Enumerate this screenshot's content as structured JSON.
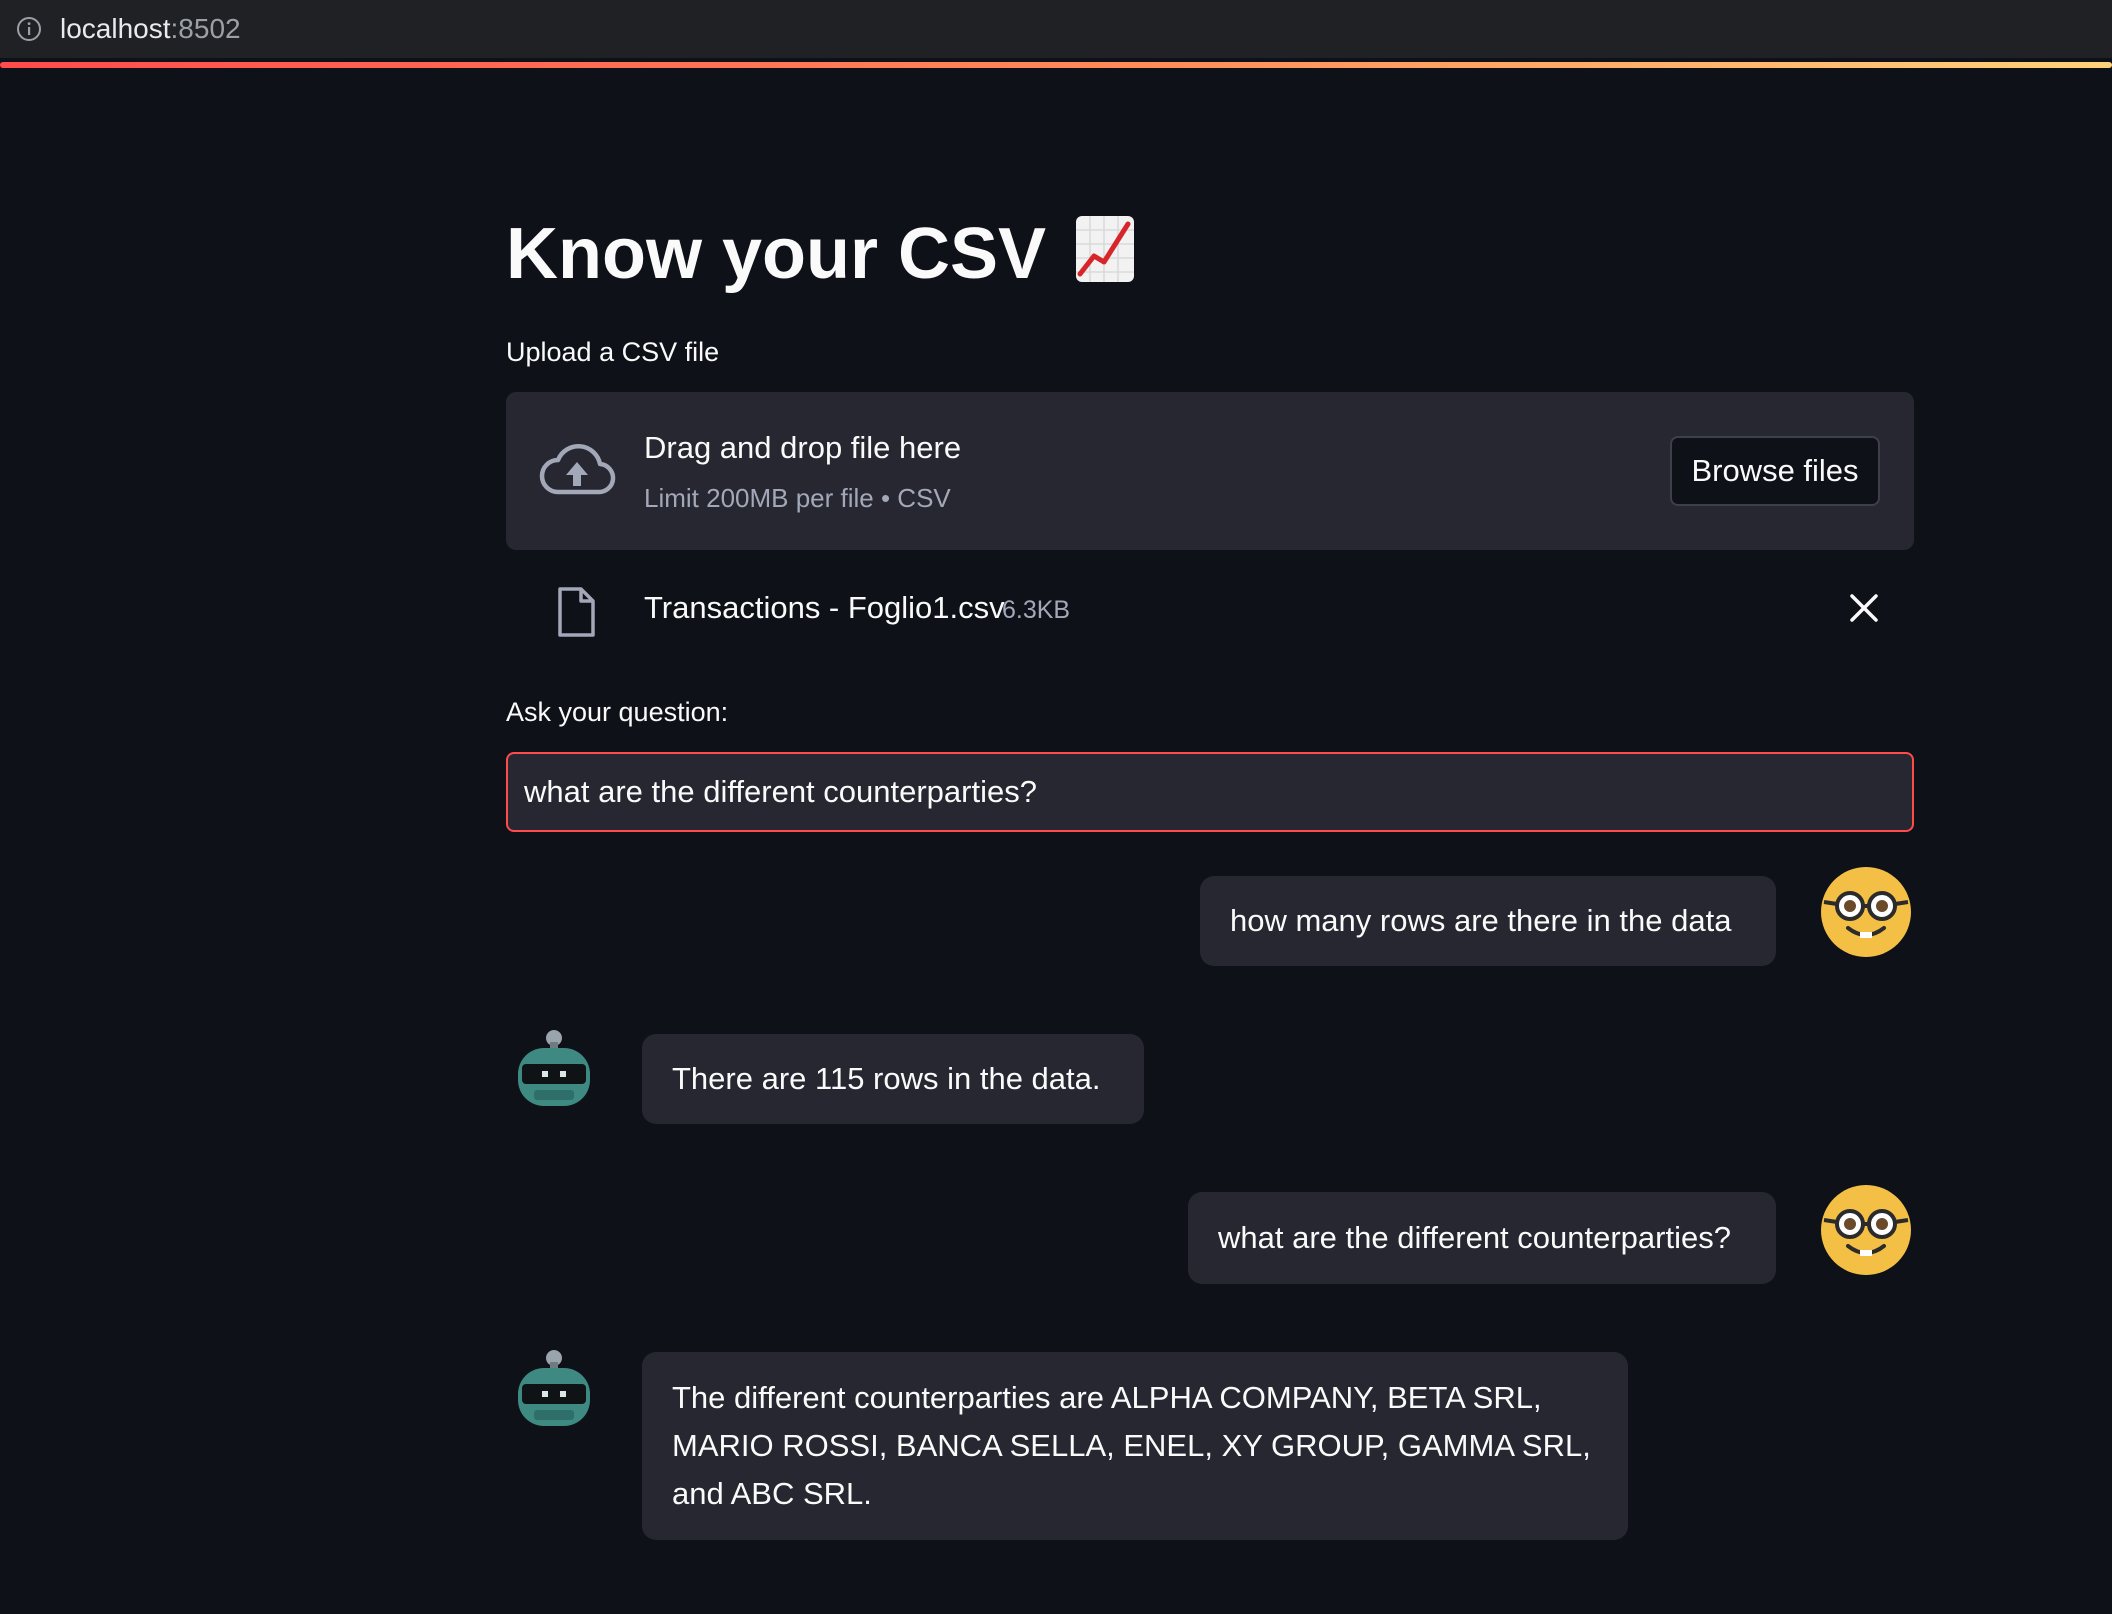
{
  "browser": {
    "url_host": "localhost",
    "url_port": ":8502"
  },
  "app": {
    "title": "Know your CSV",
    "title_icon": "chart-increasing-emoji"
  },
  "uploader": {
    "label": "Upload a CSV file",
    "drop_text": "Drag and drop file here",
    "limit_text": "Limit 200MB per file • CSV",
    "browse_label": "Browse files",
    "file_name": "Transactions - Foglio1.csv",
    "file_size": "6.3KB",
    "icons": [
      "cloud-upload-icon",
      "file-icon",
      "close-icon"
    ]
  },
  "question": {
    "label": "Ask your question:",
    "value": "what are the different counterparties?"
  },
  "chat": {
    "messages": [
      {
        "role": "user",
        "avatar": "nerd-face-avatar",
        "text": "how many rows are there in the data"
      },
      {
        "role": "assistant",
        "avatar": "robot-avatar",
        "text": "There are 115 rows in the data."
      },
      {
        "role": "user",
        "avatar": "nerd-face-avatar",
        "text": "what are the different counterparties?"
      },
      {
        "role": "assistant",
        "avatar": "robot-avatar",
        "text": "The different counterparties are ALPHA COMPANY, BETA SRL, MARIO ROSSI, BANCA SELLA, ENEL, XY GROUP, GAMMA SRL, and ABC SRL."
      }
    ]
  },
  "colors": {
    "background": "#0e1117",
    "surface": "#262730",
    "accent": "#ff4b4b",
    "muted_text": "#a3a8b8",
    "user_avatar": "#f4bf45",
    "bot_avatar": "#3e8a82"
  }
}
